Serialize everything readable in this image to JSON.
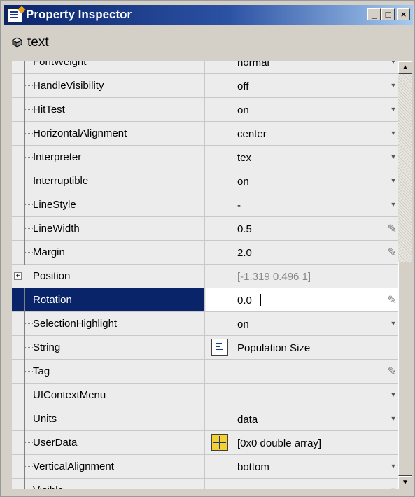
{
  "window": {
    "title": "Property Inspector",
    "minimize_label": "_",
    "maximize_label": "□",
    "close_label": "×"
  },
  "object": {
    "name": "text",
    "icon": "cube-icon"
  },
  "properties": [
    {
      "name": "FontWeight",
      "value": "normal",
      "editor": "dropdown",
      "partial": true
    },
    {
      "name": "HandleVisibility",
      "value": "off",
      "editor": "dropdown"
    },
    {
      "name": "HitTest",
      "value": "on",
      "editor": "dropdown"
    },
    {
      "name": "HorizontalAlignment",
      "value": "center",
      "editor": "dropdown"
    },
    {
      "name": "Interpreter",
      "value": "tex",
      "editor": "dropdown"
    },
    {
      "name": "Interruptible",
      "value": "on",
      "editor": "dropdown"
    },
    {
      "name": "LineStyle",
      "value": "-",
      "editor": "dropdown"
    },
    {
      "name": "LineWidth",
      "value": "0.5",
      "editor": "pencil"
    },
    {
      "name": "Margin",
      "value": "2.0",
      "editor": "pencil"
    },
    {
      "name": "Position",
      "value": "[-1.319 0.496 1]",
      "editor": "none",
      "expandable": true,
      "dim": true
    },
    {
      "name": "Rotation",
      "value": "0.0",
      "editor": "pencil",
      "selected": true
    },
    {
      "name": "SelectionHighlight",
      "value": "on",
      "editor": "dropdown"
    },
    {
      "name": "String",
      "value": "Population Size",
      "editor": "none",
      "icon": "string-editor-icon"
    },
    {
      "name": "Tag",
      "value": "",
      "editor": "pencil"
    },
    {
      "name": "UIContextMenu",
      "value": "",
      "editor": "dropdown"
    },
    {
      "name": "Units",
      "value": "data",
      "editor": "dropdown"
    },
    {
      "name": "UserData",
      "value": "[0x0  double array]",
      "editor": "none",
      "icon": "array-editor-icon"
    },
    {
      "name": "VerticalAlignment",
      "value": "bottom",
      "editor": "dropdown"
    },
    {
      "name": "Visible",
      "value": "on",
      "editor": "dropdown"
    }
  ],
  "scrollbar": {
    "up_label": "▲",
    "down_label": "▼"
  }
}
